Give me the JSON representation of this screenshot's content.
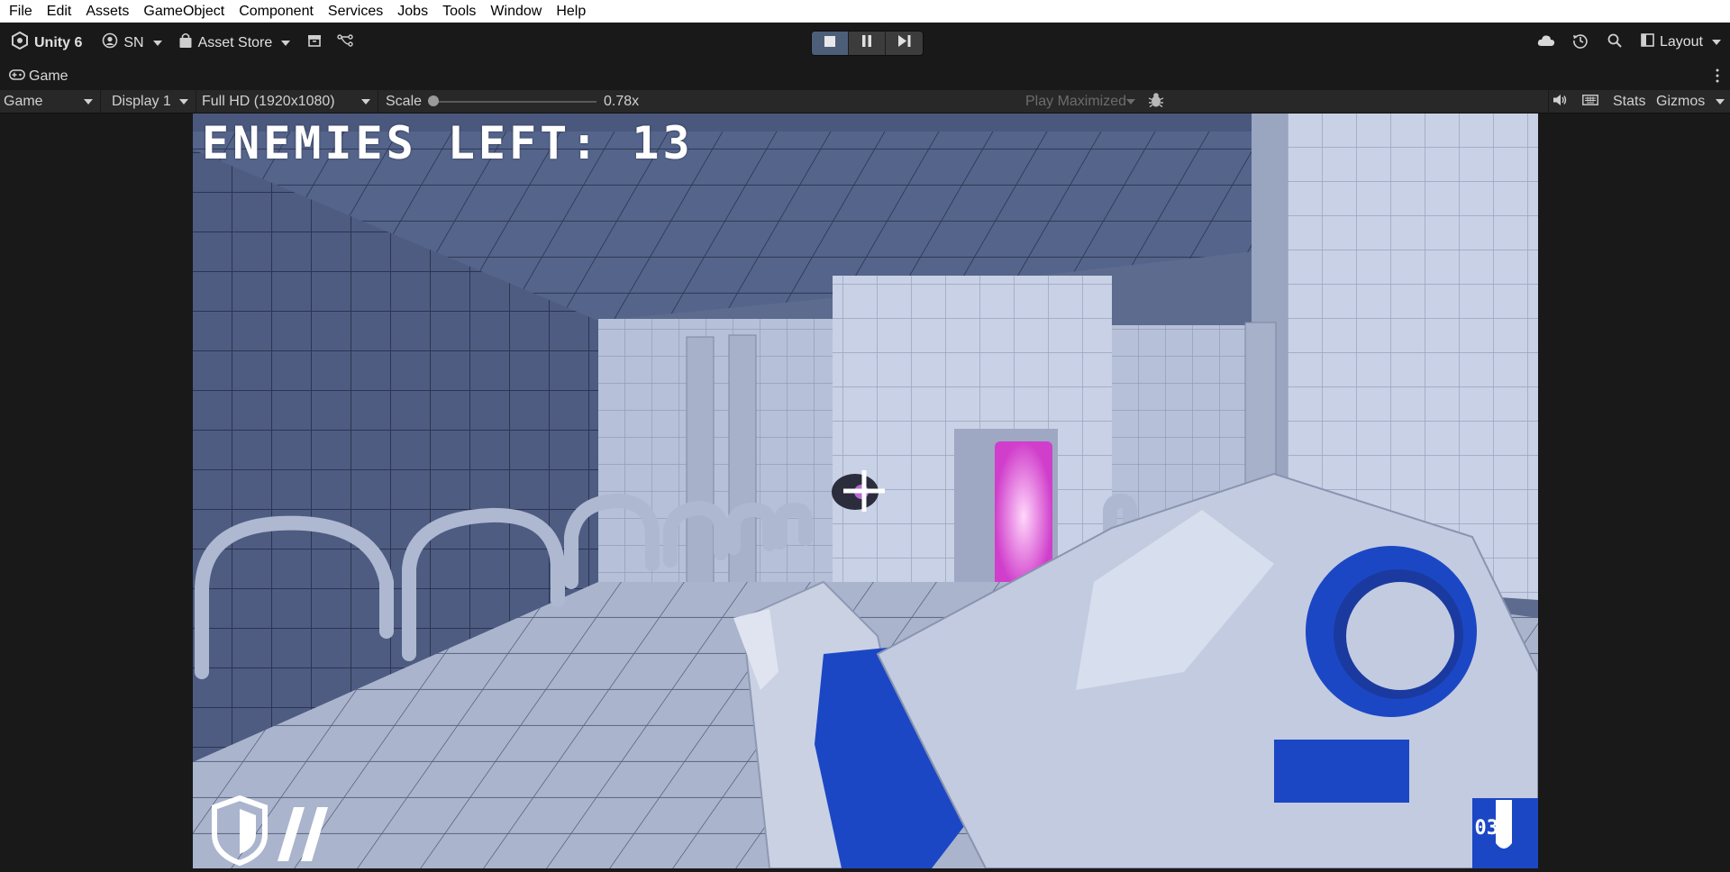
{
  "menu": [
    "File",
    "Edit",
    "Assets",
    "GameObject",
    "Component",
    "Services",
    "Jobs",
    "Tools",
    "Window",
    "Help"
  ],
  "toolbar": {
    "product": "Unity 6",
    "account": "SN",
    "asset_store": "Asset Store",
    "layout": "Layout"
  },
  "tab": {
    "title": "Game"
  },
  "game_toolbar": {
    "view_mode": "Game",
    "display": "Display 1",
    "resolution": "Full HD (1920x1080)",
    "scale_label": "Scale",
    "scale_value": "0.78x",
    "play_mode": "Play Maximized",
    "stats": "Stats",
    "gizmos": "Gizmos"
  },
  "hud": {
    "enemies_text": "ENEMIES LEFT: 13",
    "ammo": "03"
  },
  "colors": {
    "accent_play": "#4d5e79",
    "weapon_blue": "#1c47c4",
    "portal_pink": "#f3a6ee"
  }
}
